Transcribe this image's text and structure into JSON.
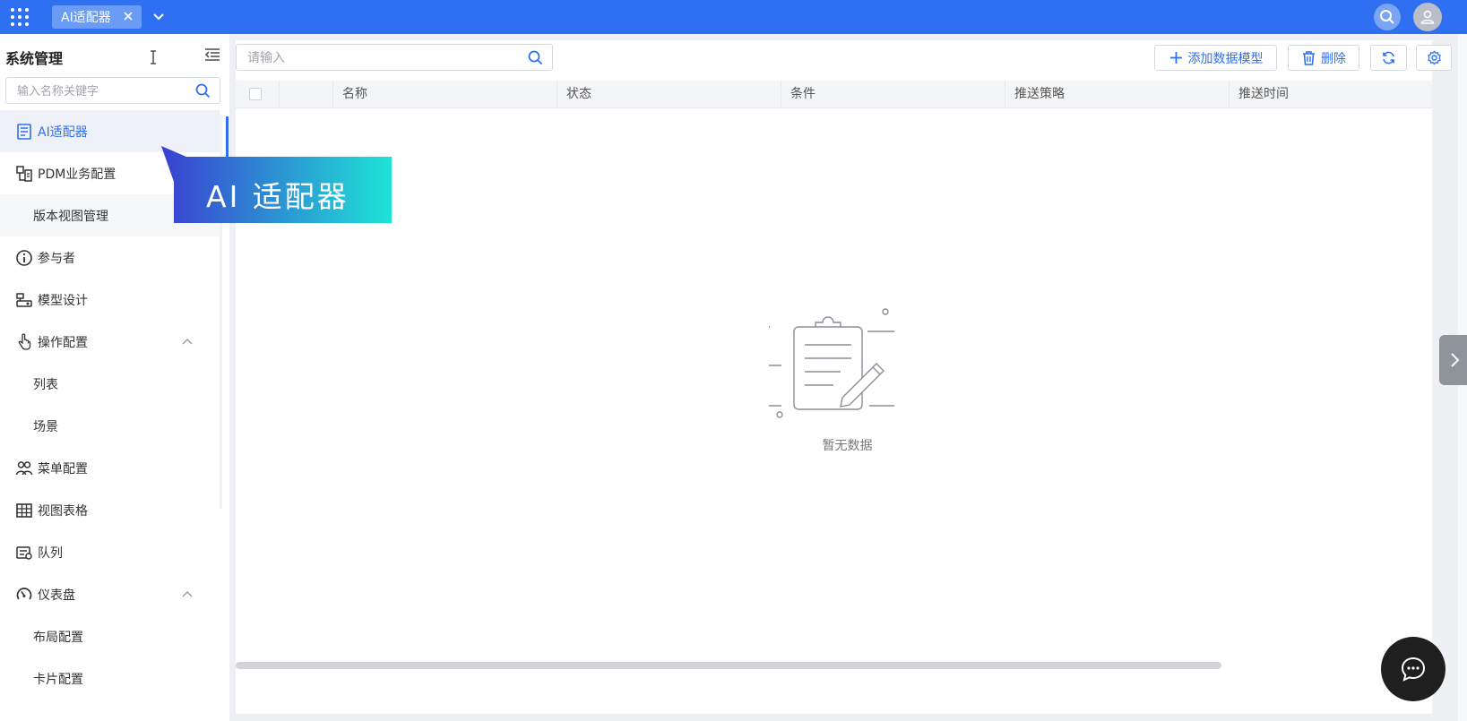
{
  "topbar": {
    "tab_label": "AI适配器",
    "icons": [
      "apps-grid-icon",
      "close-icon",
      "chevron-down-icon",
      "search-icon",
      "user-avatar-icon"
    ]
  },
  "sidebar": {
    "title": "系统管理",
    "search_placeholder": "输入名称关键字",
    "items": [
      {
        "label": "AI适配器",
        "icon": "document-list-icon",
        "active": true
      },
      {
        "label": "PDM业务配置",
        "icon": "business-config-icon"
      },
      {
        "label": "版本视图管理",
        "sub": true
      },
      {
        "label": "参与者",
        "icon": "info-circle-icon"
      },
      {
        "label": "模型设计",
        "icon": "model-design-icon"
      },
      {
        "label": "操作配置",
        "icon": "hand-pointer-icon",
        "expanded": true
      },
      {
        "label": "列表",
        "sub": true
      },
      {
        "label": "场景",
        "sub": true
      },
      {
        "label": "菜单配置",
        "icon": "users-icon"
      },
      {
        "label": "视图表格",
        "icon": "table-icon"
      },
      {
        "label": "队列",
        "icon": "queue-icon"
      },
      {
        "label": "仪表盘",
        "icon": "dashboard-icon",
        "expanded": true
      },
      {
        "label": "布局配置",
        "sub": true
      },
      {
        "label": "卡片配置",
        "sub": true
      }
    ]
  },
  "callout": {
    "label": "AI 适配器",
    "gradient_start": "#3a3fd0",
    "gradient_end": "#1ee3d6"
  },
  "main": {
    "search_placeholder": "请输入",
    "toolbar": {
      "add_label": "添加数据模型",
      "delete_label": "删除"
    },
    "table": {
      "columns": [
        "名称",
        "状态",
        "条件",
        "推送策略",
        "推送时间"
      ]
    },
    "empty_text": "暂无数据"
  },
  "colors": {
    "accent": "#2f6ff2",
    "sidebar_active_bg": "#eef1f7"
  }
}
